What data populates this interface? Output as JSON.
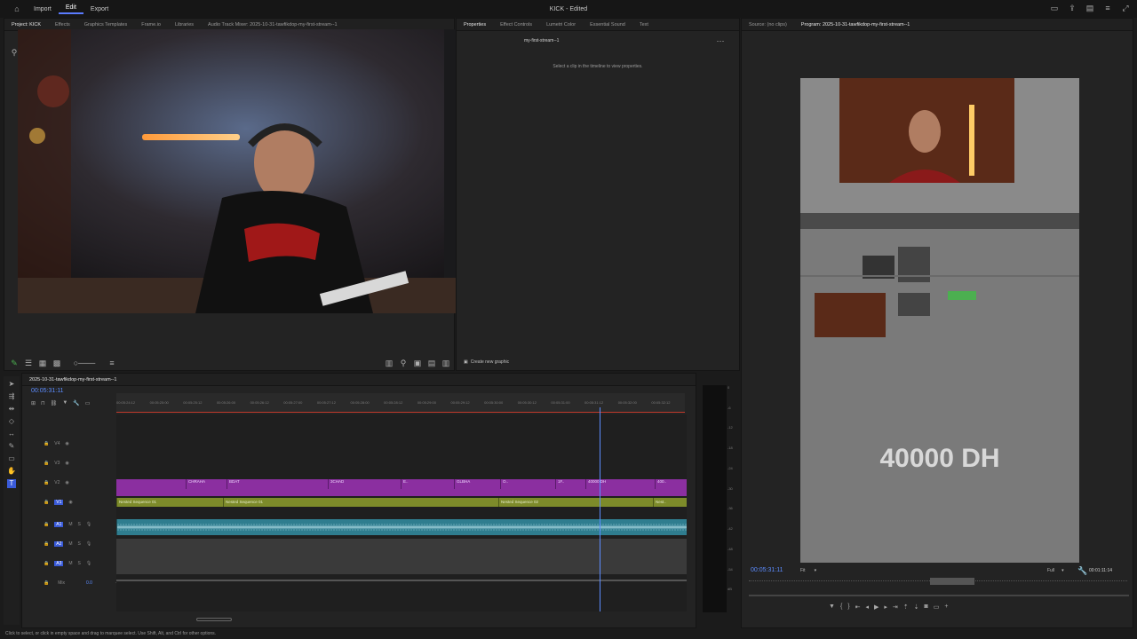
{
  "app": {
    "title": "KICK - Edited",
    "menu": [
      "Import",
      "Edit",
      "Export"
    ],
    "active_menu": "Edit"
  },
  "left_tabs": [
    "Project: KICK",
    "Effects",
    "Graphics Templates",
    "Frame.io",
    "Libraries",
    "Audio Track Mixer: 2025-10-31-tawfikdop-my-first-stream--1"
  ],
  "mid_tabs": [
    "Properties",
    "Effect Controls",
    "Lumetri Color",
    "Essential Sound",
    "Text"
  ],
  "right_tabs": [
    "Source: (no clips)",
    "Program: 2025-10-31-tawfikdop-my-first-stream--1"
  ],
  "properties": {
    "sequence_name": "my-first-stream--1",
    "hint": "Select a clip in the timeline to view properties.",
    "create_graphic": "Create new graphic"
  },
  "timeline": {
    "tab": "2025-10-31-tawfikdop-my-first-stream--1",
    "timecode": "00:05:31:11",
    "ruler": [
      "00:05:24:12",
      "00:05:25:00",
      "00:05:25:12",
      "00:05:26:00",
      "00:05:26:12",
      "00:05:27:00",
      "00:05:27:12",
      "00:05:28:00",
      "00:05:28:12",
      "00:05:29:00",
      "00:05:29:12",
      "00:05:30:00",
      "00:05:30:12",
      "00:05:31:00",
      "00:05:31:12",
      "00:05:32:00",
      "00:05:32:12"
    ],
    "tracks_video": [
      "V4",
      "V3",
      "V2",
      "V1"
    ],
    "tracks_audio": [
      "A1",
      "A2",
      "A3"
    ],
    "mix_label": "Mix",
    "mix_value": "0.0",
    "v2_clips": [
      "CHRAHA",
      "BDAT",
      "3CHAD",
      "E..",
      "GLBHA",
      "O..",
      "1F..",
      "40000 DH",
      "400.."
    ],
    "nested_clips": [
      "Nested Sequence 01",
      "Nested Sequence 01",
      "Nested Sequence 02",
      "Nest.."
    ]
  },
  "meter": {
    "scale": [
      "0",
      "-6",
      "-12",
      "-18",
      "-24",
      "-30",
      "-36",
      "-42",
      "-48",
      "-54",
      "dB"
    ]
  },
  "program": {
    "overlay_text": "40000 DH",
    "timecode": "00:05:31:11",
    "fit": "Fit",
    "quality": "Full",
    "duration": "00:01:11:14"
  },
  "status_bar": "Click to select, or click in empty space and drag to marquee select. Use Shift, Alt, and Ctrl for other options.",
  "colors": {
    "accent": "#5a7bff",
    "timecode": "#5c8cff",
    "clip_purple": "#8b2fa0",
    "clip_olive": "#7d8b2a",
    "clip_audio": "#2f7d8f"
  }
}
